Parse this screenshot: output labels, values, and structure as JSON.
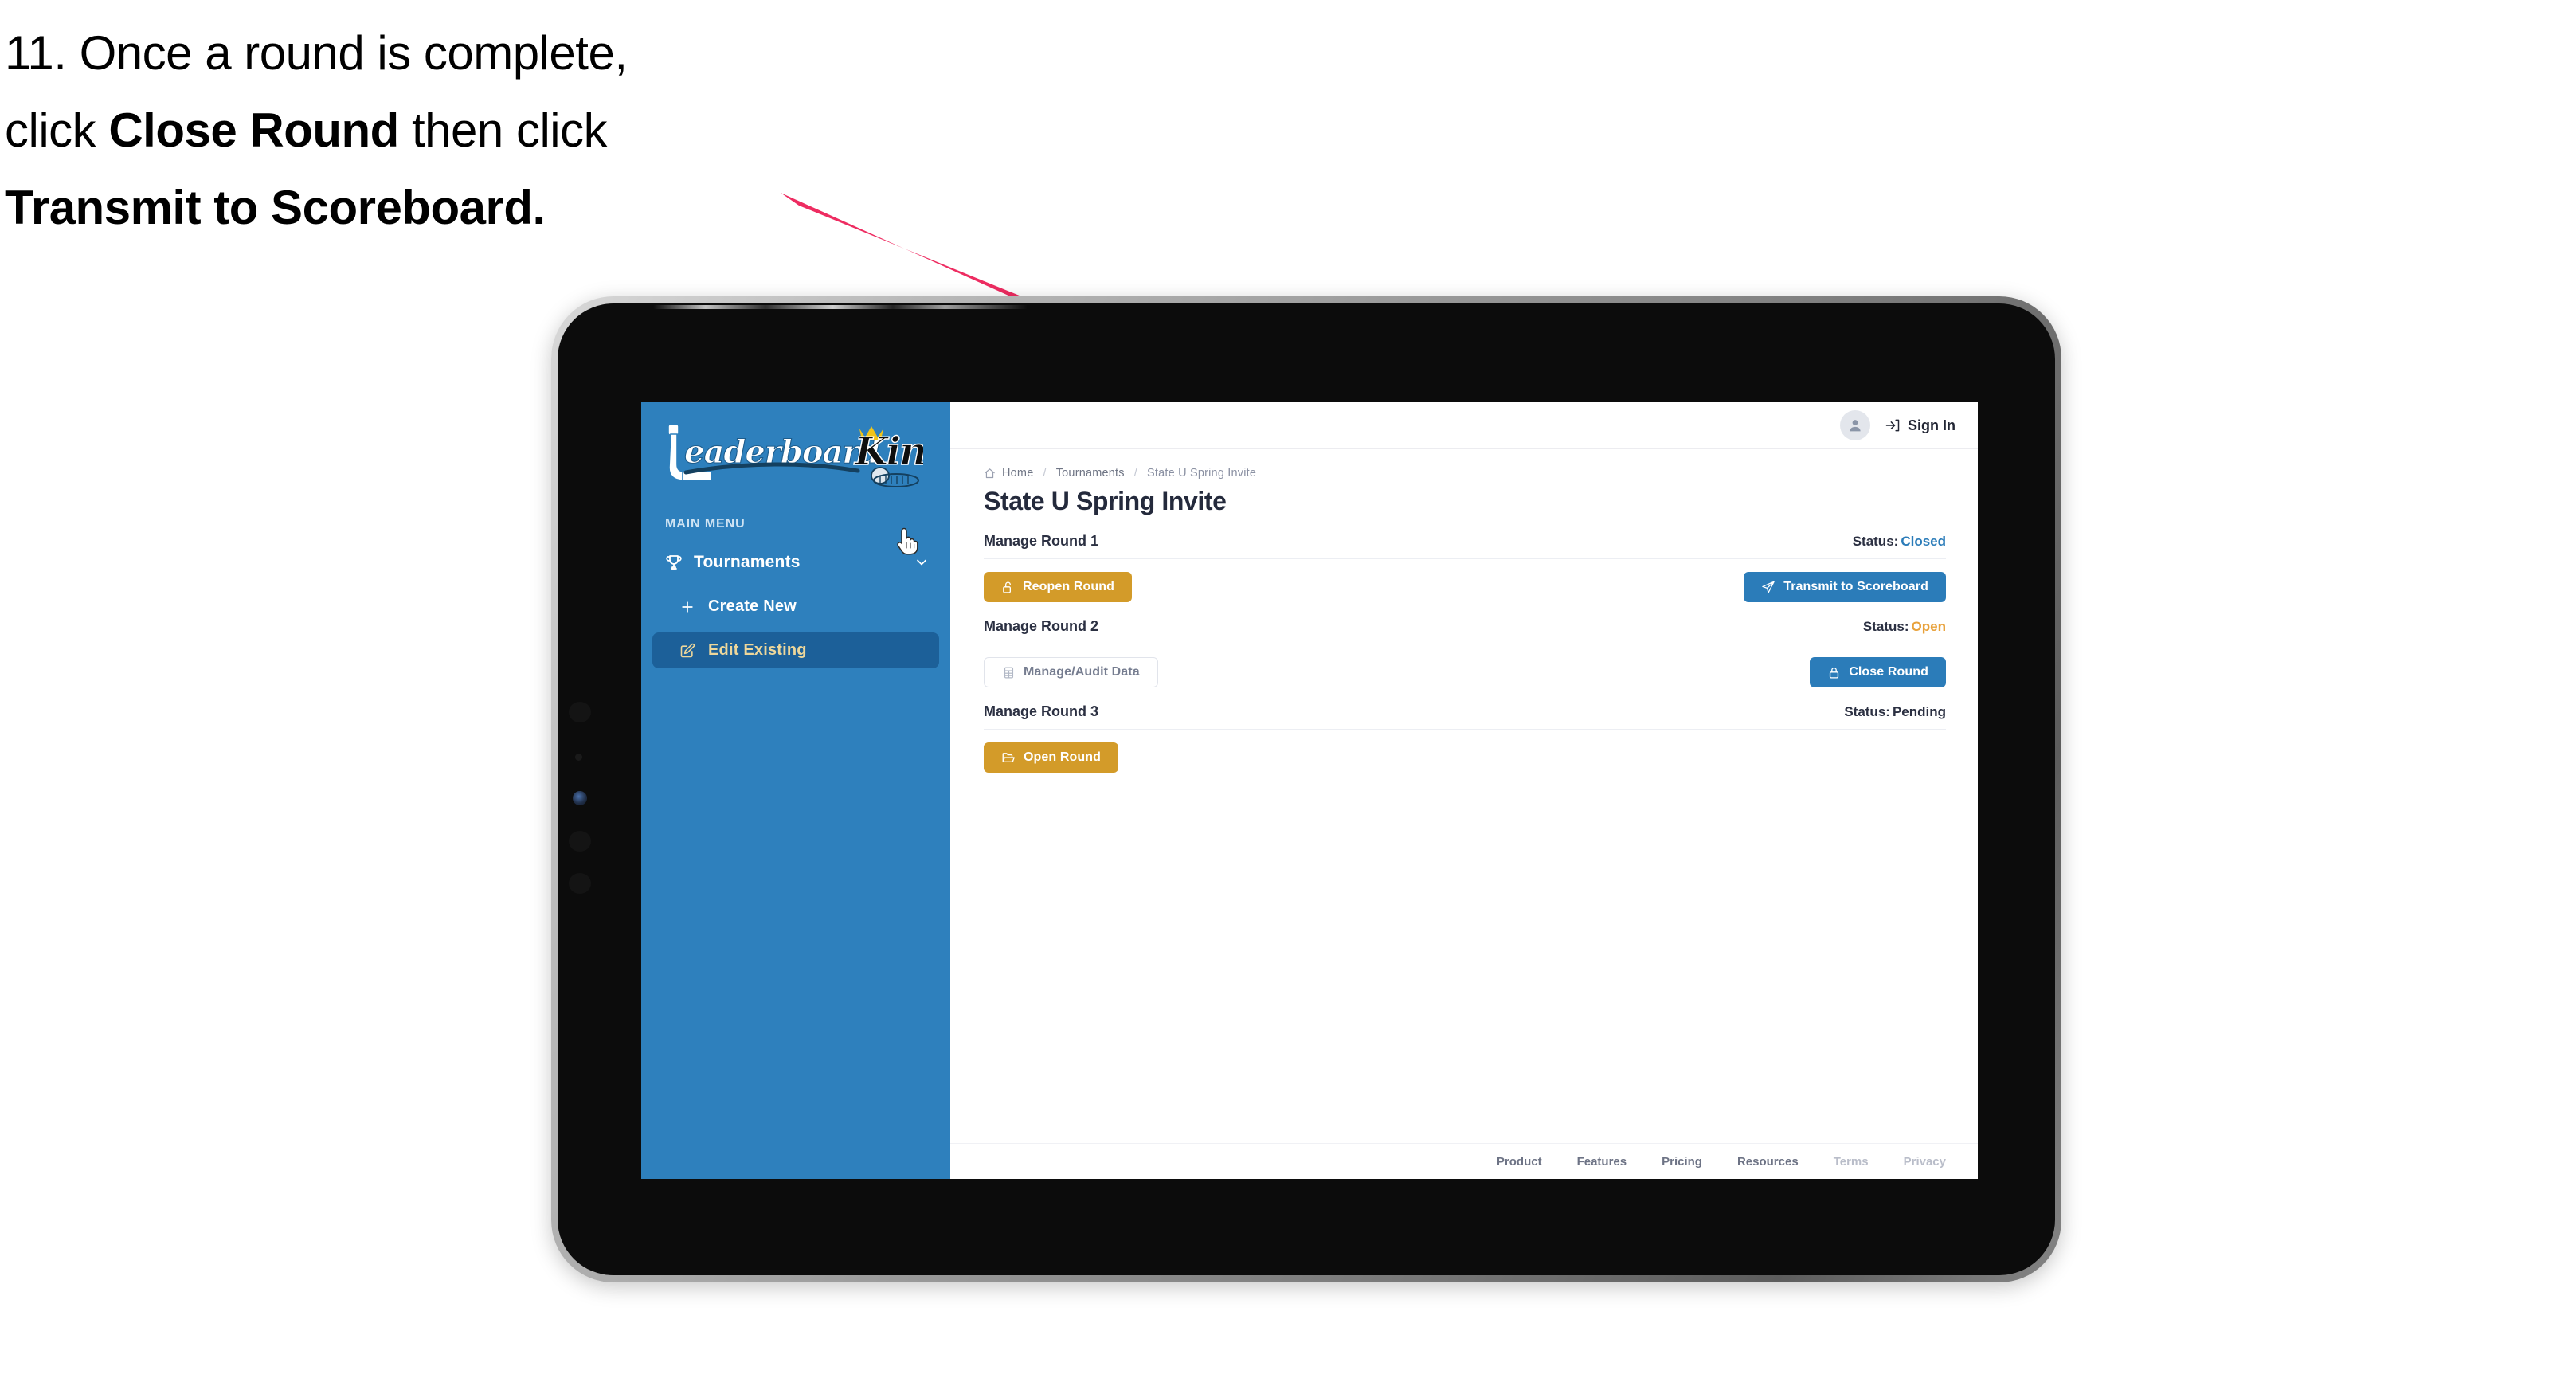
{
  "caption": {
    "line1_prefix": "11. Once a round is complete,",
    "line2_prefix": "click ",
    "line2_bold": "Close Round",
    "line2_suffix": " then click",
    "line3_bold": "Transmit to Scoreboard."
  },
  "colors": {
    "arrow": "#ee2c61",
    "sidebar_blue": "#2e80bd",
    "sidebar_active_blue": "#1c6099",
    "sidebar_active_text": "#edd79b",
    "primary_blue": "#2b7cb9",
    "gold": "#d39b29",
    "status_closed": "#2b7cb9",
    "status_open": "#e8a13a",
    "status_pending": "#2b3042",
    "title_dark": "#242a3c"
  },
  "sidebar": {
    "logo_text_1": "Leaderboard",
    "logo_text_2": "King",
    "menu_label": "MAIN MENU",
    "items": [
      {
        "label": "Tournaments",
        "icon": "trophy-icon",
        "chevron": "chevron-down-icon",
        "active": false
      },
      {
        "label": "Create New",
        "icon": "plus-icon",
        "active": false
      },
      {
        "label": "Edit Existing",
        "icon": "edit-pencil-icon",
        "active": true
      }
    ]
  },
  "topbar": {
    "avatar_icon": "user-avatar-icon",
    "signin_icon": "sign-in-arrow-icon",
    "signin_label": "Sign In"
  },
  "breadcrumb": {
    "home_icon": "home-icon",
    "items": [
      "Home",
      "Tournaments",
      "State U Spring Invite"
    ],
    "separator": "/"
  },
  "page": {
    "title": "State U Spring Invite"
  },
  "rounds": [
    {
      "title": "Manage Round 1",
      "status_label": "Status:",
      "status_value": "Closed",
      "status_color": "#2b7cb9",
      "left_button": {
        "label": "Reopen Round",
        "icon": "unlock-icon",
        "style": "gold"
      },
      "right_button": {
        "label": "Transmit to Scoreboard",
        "icon": "paper-plane-icon",
        "style": "blue"
      }
    },
    {
      "title": "Manage Round 2",
      "status_label": "Status:",
      "status_value": "Open",
      "status_color": "#e8a13a",
      "left_button": {
        "label": "Manage/Audit Data",
        "icon": "table-grid-icon",
        "style": "ghost"
      },
      "right_button": {
        "label": "Close Round",
        "icon": "lock-icon",
        "style": "blue"
      }
    },
    {
      "title": "Manage Round 3",
      "status_label": "Status:",
      "status_value": "Pending",
      "status_color": "#2b3042",
      "left_button": {
        "label": "Open Round",
        "icon": "folder-open-icon",
        "style": "gold"
      },
      "right_button": null
    }
  ],
  "footer": {
    "links": [
      {
        "label": "Product",
        "dim": false
      },
      {
        "label": "Features",
        "dim": false
      },
      {
        "label": "Pricing",
        "dim": false
      },
      {
        "label": "Resources",
        "dim": false
      },
      {
        "label": "Terms",
        "dim": true
      },
      {
        "label": "Privacy",
        "dim": true
      }
    ]
  },
  "cursor": {
    "icon": "hand-pointer-cursor"
  }
}
